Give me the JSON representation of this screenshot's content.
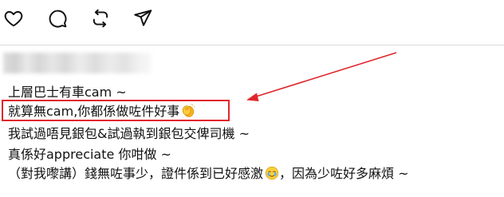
{
  "action_bar": {
    "icons": [
      "heart-icon",
      "comment-bubble-icon",
      "repost-icon",
      "send-icon"
    ]
  },
  "comment": {
    "lines": [
      "上層巴士有車cam ~",
      "就算無cam,你都係做咗件好事",
      "我試過唔見銀包&試過執到銀包交俾司機 ~",
      "真係好appreciate 你咁做 ~",
      "（對我嚟講）錢無咗事少，證件係到已好感激",
      "，因為少咗好多麻煩 ~"
    ],
    "emoji_clap": "clapping-hands-emoji",
    "emoji_relief": "relieved-crying-face-emoji"
  },
  "annotation": {
    "box_color": "#e0262c",
    "arrow_color": "#e0262c"
  },
  "colors": {
    "text": "#111111",
    "divider": "#dbdbdb",
    "background": "#ffffff"
  }
}
